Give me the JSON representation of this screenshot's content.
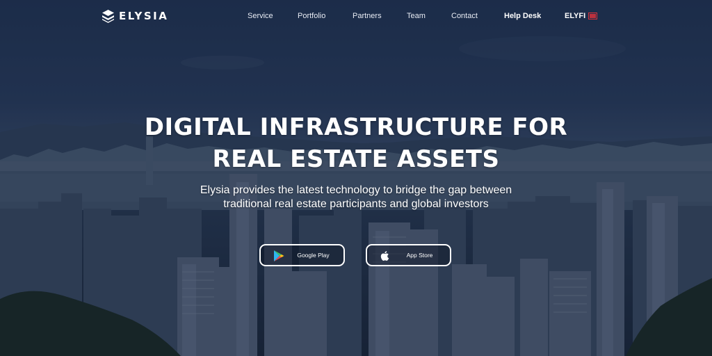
{
  "brand": {
    "name": "ELYSIA",
    "logo_icon": "stacked-layers-icon"
  },
  "nav": {
    "items": [
      {
        "label": "Service"
      },
      {
        "label": "Portfolio"
      },
      {
        "label": "Partners"
      },
      {
        "label": "Team"
      },
      {
        "label": "Contact"
      },
      {
        "label": "Help Desk"
      },
      {
        "label": "ELYFI"
      }
    ],
    "flag_icon": "korean-flag-icon"
  },
  "hero": {
    "title_line1": "DIGITAL INFRASTRUCTURE FOR",
    "title_line2": "REAL ESTATE ASSETS",
    "subtitle_line1": "Elysia provides the latest technology to bridge the gap between",
    "subtitle_line2": "traditional real estate participants and global investors",
    "background": "hong-kong-skyline-photo"
  },
  "buttons": {
    "google_play": {
      "label": "Google Play",
      "icon": "google-play-icon"
    },
    "app_store": {
      "label": "App Store",
      "icon": "apple-icon"
    }
  },
  "colors": {
    "overlay": "#1a2740",
    "text": "#ffffff",
    "button_border": "#ffffff",
    "flag_accent": "#d8323c"
  }
}
